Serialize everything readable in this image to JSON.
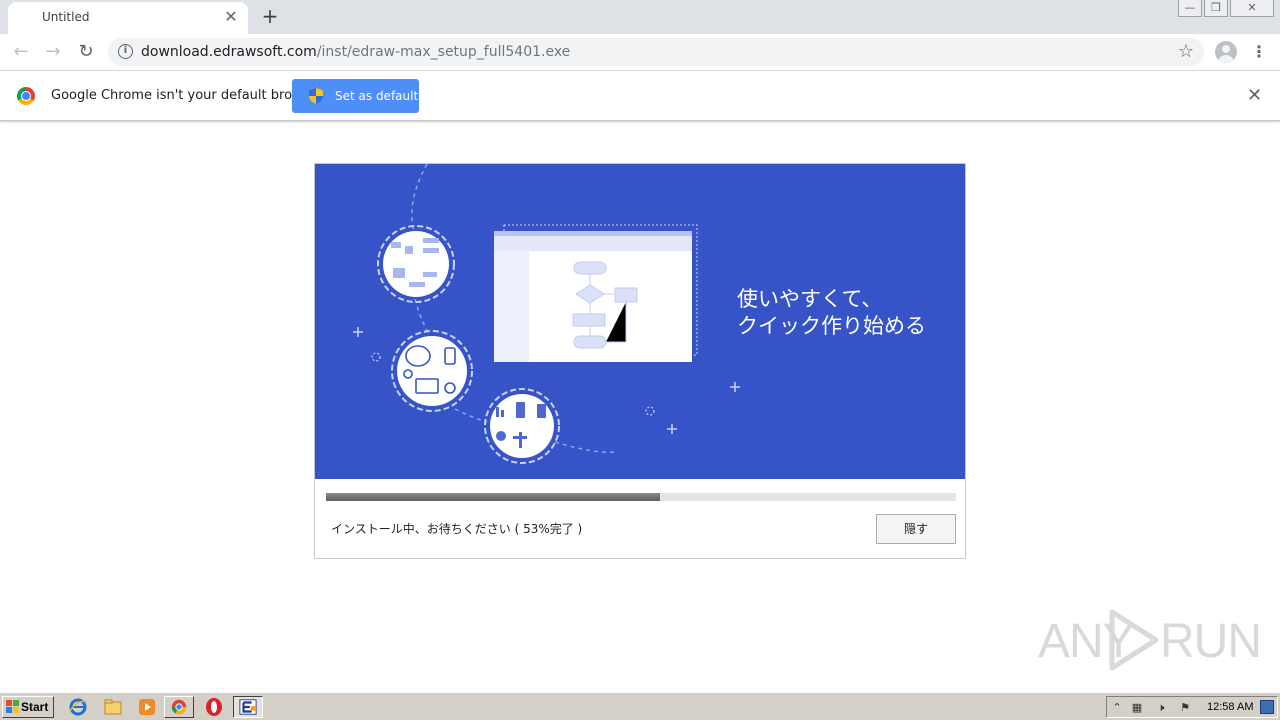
{
  "browser": {
    "tab_title": "Untitled",
    "tab_close": "✕",
    "new_tab": "+",
    "window_controls": [
      "—",
      "❐",
      "✕"
    ],
    "url_host": "download.edrawsoft.com",
    "url_path": "/inst/edraw-max_setup_full5401.exe",
    "icons": [
      "back-icon",
      "forward-icon",
      "reload-icon",
      "info-icon",
      "star-icon",
      "profile-icon",
      "menu-icon"
    ]
  },
  "infobar": {
    "message": "Google Chrome isn't your default browser",
    "button_label": "Set as default",
    "close": "✕"
  },
  "installer": {
    "tagline_line1": "使いやすくて、",
    "tagline_line2": "クイック作り始める",
    "progress": 0.53,
    "status": "インストール中、お待ちください ( 53%完了 )",
    "hide_button": "隠す",
    "colors": {
      "banner": "#3653c8",
      "progress": "#6e6e6e"
    }
  },
  "watermark": {
    "left": "ANY",
    "right": "RUN"
  },
  "taskbar": {
    "start_label": "Start",
    "clock": "12:58 AM",
    "quick_launch": [
      "ie-icon",
      "explorer-icon",
      "media-player-icon"
    ],
    "tasks": [
      "chrome-icon",
      "opera-icon",
      "edraw-icon"
    ],
    "tray_icons": [
      "expand-icon",
      "network-icon",
      "volume-icon",
      "flag-icon"
    ]
  }
}
